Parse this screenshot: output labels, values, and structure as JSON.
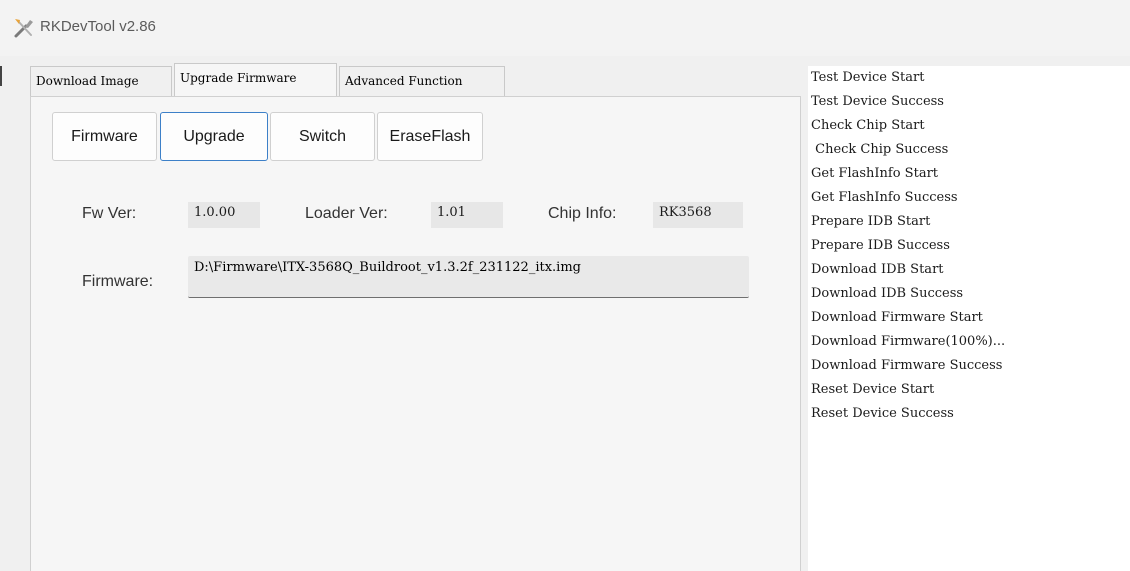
{
  "window": {
    "title": "RKDevTool v2.86",
    "icon": "tools-icon"
  },
  "tabs": [
    {
      "label": "Download Image",
      "active": false
    },
    {
      "label": "Upgrade Firmware",
      "active": true
    },
    {
      "label": "Advanced Function",
      "active": false
    }
  ],
  "toolbar": {
    "firmware_label": "Firmware",
    "upgrade_label": "Upgrade",
    "switch_label": "Switch",
    "eraseflash_label": "EraseFlash"
  },
  "info": {
    "fw_ver_label": "Fw Ver:",
    "fw_ver_value": "1.0.00",
    "loader_ver_label": "Loader Ver:",
    "loader_ver_value": "1.01",
    "chip_info_label": "Chip Info:",
    "chip_info_value": "RK3568",
    "firmware_label": "Firmware:",
    "firmware_path": "D:\\Firmware\\ITX-3568Q_Buildroot_v1.3.2f_231122_itx.img"
  },
  "log": [
    "Test Device Start",
    "Test Device Success",
    "Check Chip Start",
    " Check Chip Success",
    "Get FlashInfo Start",
    "Get FlashInfo Success",
    "Prepare IDB Start",
    "Prepare IDB Success",
    "Download IDB Start",
    "Download IDB Success",
    "Download Firmware Start",
    "Download Firmware(100%)...",
    "Download Firmware Success",
    "Reset Device Start",
    "Reset Device Success"
  ]
}
